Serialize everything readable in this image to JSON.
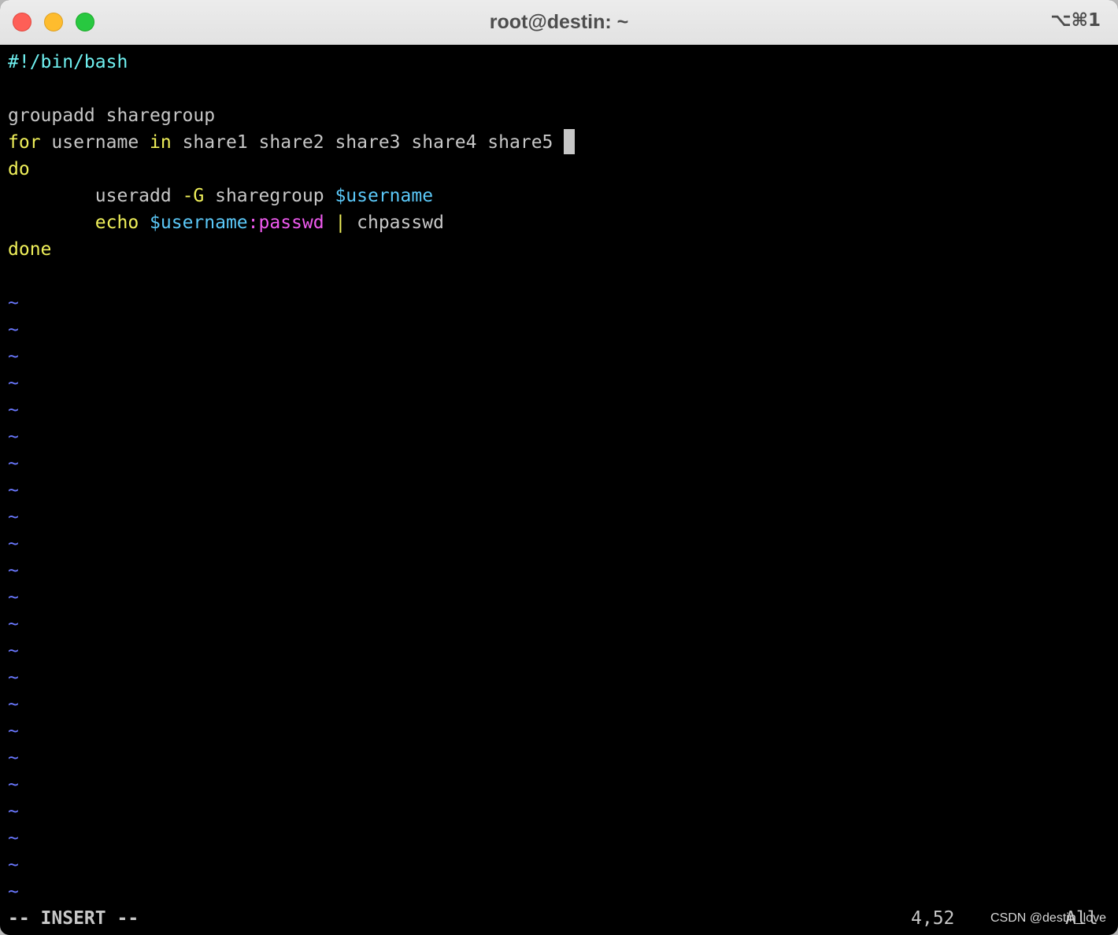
{
  "window": {
    "title": "root@destin: ~",
    "shortcut": "⌥⌘1"
  },
  "editor": {
    "lines": [
      {
        "text": "#!/bin/bash"
      },
      {
        "text": ""
      },
      {
        "text": "groupadd sharegroup"
      },
      {
        "kw_for": "for",
        "var": " username ",
        "kw_in": "in",
        "list": " share1 share2 share3 share4 share5 "
      },
      {
        "text": "do"
      },
      {
        "indent": "        ",
        "cmd": "useradd ",
        "flag": "-G",
        "arg": " sharegroup ",
        "var": "$username"
      },
      {
        "indent": "        ",
        "cmd": "echo",
        "sp": " ",
        "var": "$username",
        "str": ":passwd",
        "pipe": " | ",
        "cmd2": "chpasswd"
      },
      {
        "text": "done"
      },
      {
        "text": ""
      }
    ],
    "tilde": "~"
  },
  "status": {
    "mode": "-- INSERT --",
    "position": "4,52",
    "scroll": "All"
  },
  "watermark": "CSDN @destin_love",
  "colors": {
    "background": "#000000",
    "text": "#c7c7c7",
    "keyword": "#f0f05a",
    "shebang": "#6ff0f0",
    "variable": "#5bc8f8",
    "string": "#f05af0",
    "tilde": "#6a78ff",
    "close": "#fe5f57",
    "minimize": "#febc2e",
    "maximize": "#28c840"
  }
}
